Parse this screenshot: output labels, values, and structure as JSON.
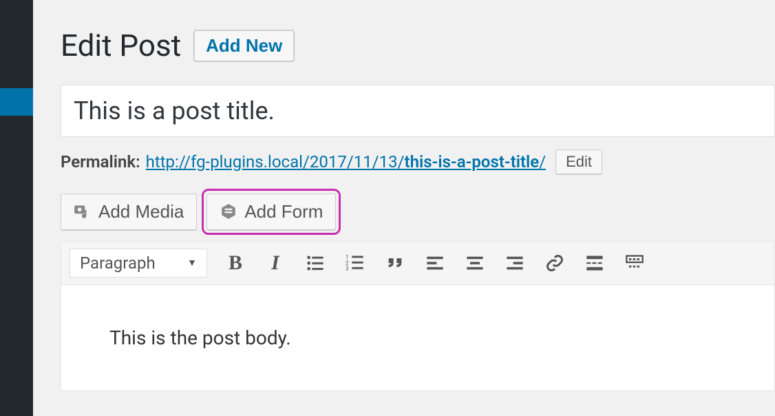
{
  "page": {
    "heading": "Edit Post",
    "add_new_label": "Add New"
  },
  "post": {
    "title": "This is a post title.",
    "body": "This is the post body."
  },
  "permalink": {
    "label": "Permalink:",
    "base": "http://fg-plugins.local/2017/11/13/",
    "slug": "this-is-a-post-title",
    "trail": "/",
    "edit_label": "Edit"
  },
  "media": {
    "add_media_label": "Add Media",
    "add_form_label": "Add Form"
  },
  "toolbar": {
    "format": "Paragraph"
  }
}
